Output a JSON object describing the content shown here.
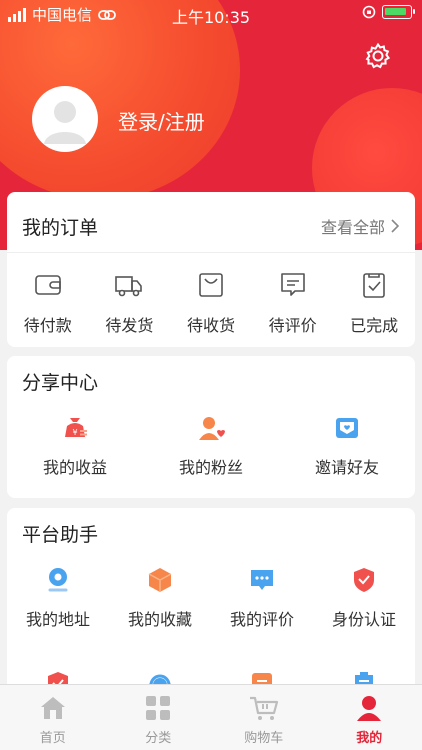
{
  "status_bar": {
    "carrier": "中国电信",
    "time": "上午10:35"
  },
  "profile": {
    "login_label": "登录/注册"
  },
  "orders": {
    "title": "我的订单",
    "view_all": "查看全部",
    "items": [
      {
        "label": "待付款",
        "icon": "wallet-icon"
      },
      {
        "label": "待发货",
        "icon": "truck-icon"
      },
      {
        "label": "待收货",
        "icon": "bag-icon"
      },
      {
        "label": "待评价",
        "icon": "comment-icon"
      },
      {
        "label": "已完成",
        "icon": "clipboard-check-icon"
      }
    ]
  },
  "share_center": {
    "title": "分享中心",
    "items": [
      {
        "label": "我的收益",
        "icon": "money-bag-icon"
      },
      {
        "label": "我的粉丝",
        "icon": "fans-icon"
      },
      {
        "label": "邀请好友",
        "icon": "invite-icon"
      }
    ]
  },
  "platform": {
    "title": "平台助手",
    "items": [
      {
        "label": "我的地址",
        "icon": "location-icon"
      },
      {
        "label": "我的收藏",
        "icon": "box-icon"
      },
      {
        "label": "我的评价",
        "icon": "chat-bubble-icon"
      },
      {
        "label": "身份认证",
        "icon": "shield-check-icon"
      },
      {
        "label": "",
        "icon": "security-shield-icon"
      },
      {
        "label": "",
        "icon": "customer-service-icon"
      },
      {
        "label": "",
        "icon": "document-icon"
      },
      {
        "label": "",
        "icon": "building-icon"
      }
    ]
  },
  "tabbar": {
    "items": [
      {
        "label": "首页",
        "icon": "home-icon"
      },
      {
        "label": "分类",
        "icon": "category-icon"
      },
      {
        "label": "购物车",
        "icon": "cart-icon"
      },
      {
        "label": "我的",
        "icon": "user-icon"
      }
    ]
  },
  "colors": {
    "brand_red": "#e5263a",
    "orange_blob": "#f44a2e",
    "icon_orange": "#f7864a",
    "icon_blue": "#4aa3ee",
    "icon_red": "#f0514d"
  }
}
